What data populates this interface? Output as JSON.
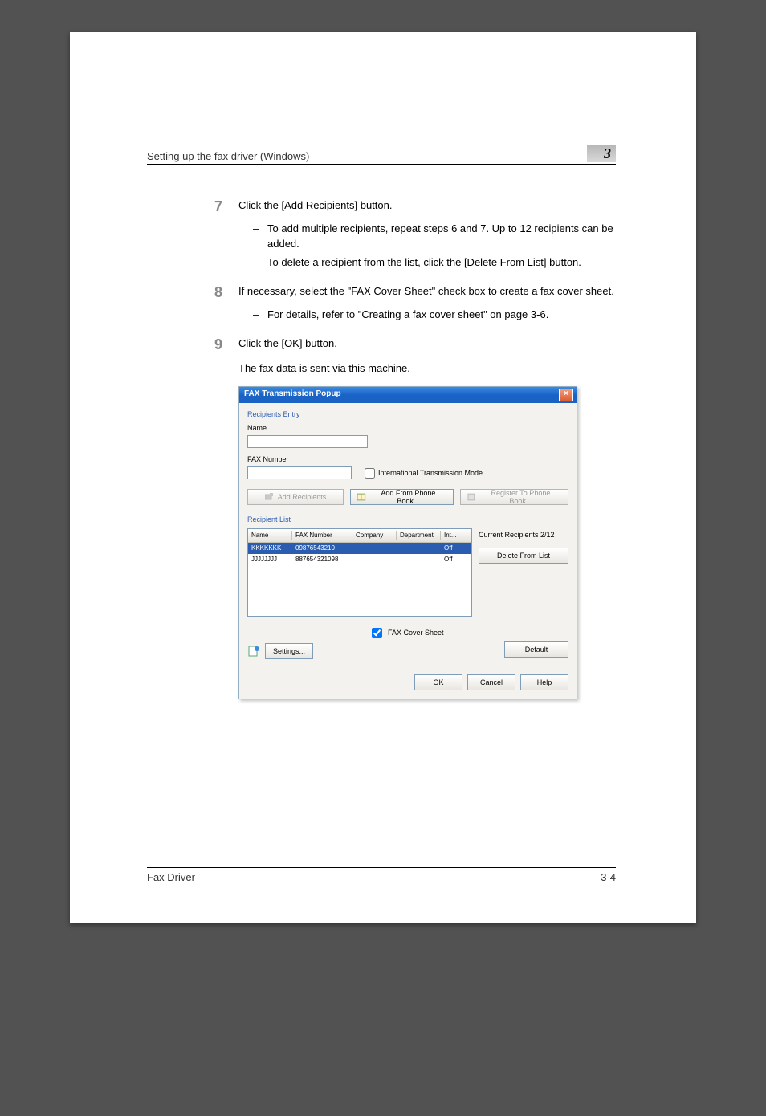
{
  "header": {
    "section": "Setting up the fax driver (Windows)",
    "chapter": "3"
  },
  "steps": {
    "s7": {
      "num": "7",
      "text": "Click the [Add Recipients] button.",
      "sub1": "To add multiple recipients, repeat steps 6 and 7. Up to 12 recipients can be added.",
      "sub2": "To delete a recipient from the list, click the [Delete From List] button."
    },
    "s8": {
      "num": "8",
      "text": "If necessary, select the \"FAX Cover Sheet\" check box to create a fax cover sheet.",
      "sub1": "For details, refer to \"Creating a fax cover sheet\" on page 3-6."
    },
    "s9": {
      "num": "9",
      "text": "Click the [OK] button.",
      "para": "The fax data is sent via this machine."
    }
  },
  "dialog": {
    "title": "FAX Transmission Popup",
    "recipients_entry": "Recipients Entry",
    "name_label": "Name",
    "fax_label": "FAX Number",
    "intl_mode": "International Transmission Mode",
    "btn_add": "Add Recipients",
    "btn_addfrom": "Add From Phone Book...",
    "btn_register": "Register To Phone Book...",
    "recipient_list": "Recipient List",
    "cols": {
      "name": "Name",
      "fax": "FAX Number",
      "company": "Company",
      "dept": "Department",
      "intl": "Int..."
    },
    "rows": [
      {
        "name": "KKKKKKK",
        "fax": "09876543210",
        "company": "",
        "dept": "",
        "intl": "Off"
      },
      {
        "name": "JJJJJJJJ",
        "fax": "887654321098",
        "company": "",
        "dept": "",
        "intl": "Off"
      }
    ],
    "current_recipients": "Current Recipients 2/12",
    "btn_delete": "Delete From List",
    "cover_sheet": "FAX Cover Sheet",
    "btn_settings": "Settings...",
    "btn_default": "Default",
    "btn_ok": "OK",
    "btn_cancel": "Cancel",
    "btn_help": "Help"
  },
  "footer": {
    "left": "Fax Driver",
    "right": "3-4"
  }
}
